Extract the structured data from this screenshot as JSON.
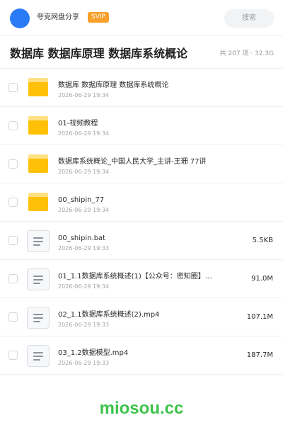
{
  "header": {
    "account_name": "夸克网盘分享",
    "badge": "SVIP",
    "search_placeholder": "搜索"
  },
  "folder": {
    "title": "数据库 数据库原理 数据库系统概论",
    "stats": "共 207 项 · 32.3G"
  },
  "files": [
    {
      "type": "folder",
      "name": "数据库 数据库原理 数据库系统概论",
      "date": "2026-06-29 19:34",
      "size": ""
    },
    {
      "type": "folder",
      "name": "01-视频教程",
      "date": "2026-06-29 19:34",
      "size": ""
    },
    {
      "type": "folder",
      "name": "数据库系统概论_中国人民大学_主讲-王珊 77讲",
      "date": "2026-06-29 19:34",
      "size": ""
    },
    {
      "type": "folder",
      "name": "00_shipin_77",
      "date": "2026-06-29 19:34",
      "size": ""
    },
    {
      "type": "file",
      "name": "00_shipin.bat",
      "date": "2026-06-29 19:33",
      "size": "5.5KB"
    },
    {
      "type": "file",
      "name": "01_1.1数据库系统概述(1)【公众号：密知圈】…",
      "date": "2026-06-29 19:34",
      "size": "91.0M"
    },
    {
      "type": "file",
      "name": "02_1.1数据库系统概述(2).mp4",
      "date": "2026-06-29 19:33",
      "size": "107.1M"
    },
    {
      "type": "file",
      "name": "03_1.2数据模型.mp4",
      "date": "2026-06-29 19:33",
      "size": "187.7M"
    }
  ],
  "watermark": "miosou.cc",
  "colors": {
    "avatar": "#2b7bf6",
    "svip_badge": "#f7a02b",
    "folder": "#ffc107",
    "watermark": "#3ec24a"
  }
}
